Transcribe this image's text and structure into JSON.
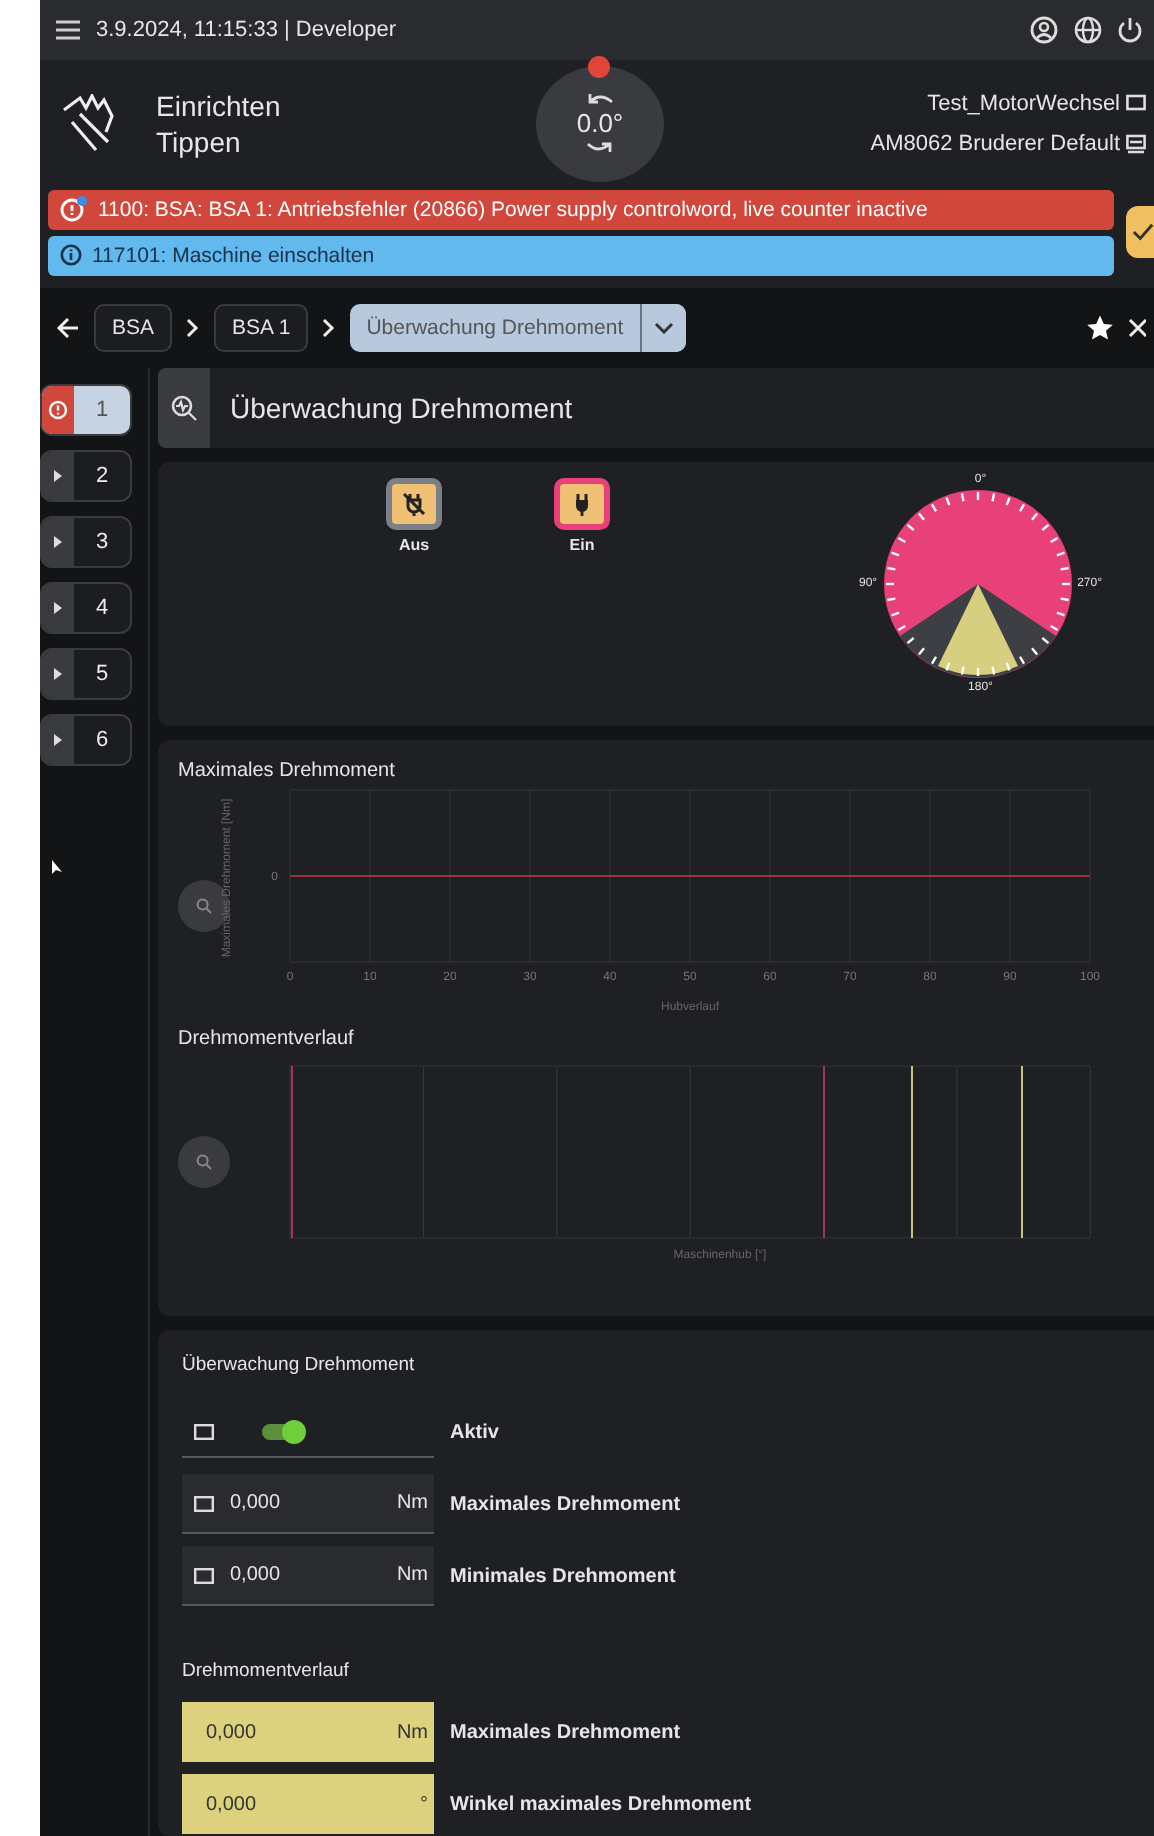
{
  "top_bar": {
    "status": "3.9.2024, 11:15:33 | Developer"
  },
  "header": {
    "mode": [
      "Einrichten",
      "Tippen"
    ],
    "dial_value": "0.0°",
    "program": "Test_MotorWechsel",
    "profile": "AM8062 Bruderer Default"
  },
  "alerts": [
    {
      "kind": "error",
      "text": "1100: BSA: BSA 1: Antriebsfehler (20866) Power supply controlword, live counter inactive"
    },
    {
      "kind": "info",
      "text": "117101: Maschine einschalten"
    }
  ],
  "breadcrumb": {
    "items": [
      "BSA",
      "BSA 1"
    ],
    "current": "Überwachung Drehmoment"
  },
  "sidebar": {
    "items": [
      {
        "label": "1",
        "kind": "error",
        "selected": true
      },
      {
        "label": "2",
        "kind": "normal",
        "selected": false
      },
      {
        "label": "3",
        "kind": "normal",
        "selected": false
      },
      {
        "label": "4",
        "kind": "normal",
        "selected": false
      },
      {
        "label": "5",
        "kind": "normal",
        "selected": false
      },
      {
        "label": "6",
        "kind": "normal",
        "selected": false
      }
    ]
  },
  "page_title": "Überwachung Drehmoment",
  "power_buttons": [
    {
      "label": "Aus",
      "kind": "off",
      "selected": false
    },
    {
      "label": "Ein",
      "kind": "on",
      "selected": true
    }
  ],
  "angle_gauge": {
    "labels": [
      "0°",
      "90°",
      "270°",
      "180°"
    ]
  },
  "charts": {
    "max_title": "Maximales Drehmoment",
    "max_plot": {
      "ylabel": "Maximales Drehmoment [Nm]",
      "xlabel": "Hubverlauf",
      "x_tick_labels": [
        "0",
        "10",
        "20",
        "30",
        "40",
        "50",
        "60",
        "70",
        "80",
        "90",
        "100"
      ],
      "y_tick_labels": [
        "0"
      ]
    },
    "curve_title": "Drehmomentverlauf",
    "curve_xlabel": "Maschinenhub [°]"
  },
  "settings": {
    "title": "Überwachung Drehmoment",
    "rows": [
      {
        "kind": "toggle",
        "on": true,
        "label": "Aktiv"
      },
      {
        "kind": "input",
        "value": "0,000",
        "unit": "Nm",
        "label": "Maximales Drehmoment"
      },
      {
        "kind": "input",
        "value": "0,000",
        "unit": "Nm",
        "label": "Minimales Drehmoment"
      }
    ],
    "curve_title": "Drehmomentverlauf",
    "curve_rows": [
      {
        "kind": "readout",
        "value": "0,000",
        "unit": "Nm",
        "label": "Maximales Drehmoment"
      },
      {
        "kind": "readout",
        "value": "0,000",
        "unit": "°",
        "label": "Winkel maximales Drehmoment"
      }
    ]
  }
}
